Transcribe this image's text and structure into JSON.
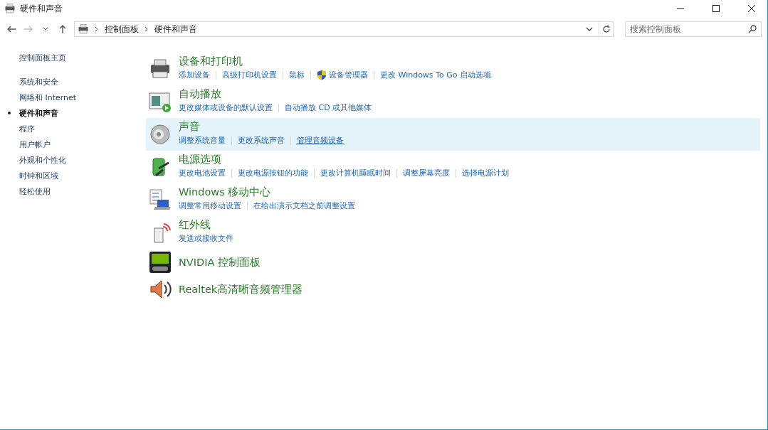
{
  "window": {
    "title": "硬件和声音"
  },
  "address_bar": {
    "path": [
      "控制面板",
      "硬件和声音"
    ]
  },
  "search": {
    "placeholder": "搜索控制面板"
  },
  "sidebar": {
    "home": "控制面板主页",
    "items": [
      {
        "label": "系统和安全",
        "selected": false
      },
      {
        "label": "网络和 Internet",
        "selected": false
      },
      {
        "label": "硬件和声音",
        "selected": true
      },
      {
        "label": "程序",
        "selected": false
      },
      {
        "label": "用户帐户",
        "selected": false
      },
      {
        "label": "外观和个性化",
        "selected": false
      },
      {
        "label": "时钟和区域",
        "selected": false
      },
      {
        "label": "轻松使用",
        "selected": false
      }
    ]
  },
  "sections": [
    {
      "kind": "printer",
      "title": "设备和打印机",
      "selected": false,
      "links": [
        {
          "kind": "plain",
          "label": "添加设备",
          "hovered": false
        },
        {
          "kind": "plain",
          "label": "高级打印机设置",
          "hovered": false
        },
        {
          "kind": "plain",
          "label": "鼠标",
          "hovered": false
        },
        {
          "kind": "admin",
          "label": "设备管理器",
          "hovered": false
        },
        {
          "kind": "plain",
          "label": "更改 Windows To Go 启动选项",
          "hovered": false
        }
      ]
    },
    {
      "kind": "autoplay",
      "title": "自动播放",
      "selected": false,
      "links": [
        {
          "kind": "plain",
          "label": "更改媒体或设备的默认设置",
          "hovered": false
        },
        {
          "kind": "plain",
          "label": "自动播放 CD 或其他媒体",
          "hovered": false
        }
      ]
    },
    {
      "kind": "sound",
      "title": "声音",
      "selected": true,
      "links": [
        {
          "kind": "plain",
          "label": "调整系统音量",
          "hovered": false
        },
        {
          "kind": "plain",
          "label": "更改系统声音",
          "hovered": false
        },
        {
          "kind": "plain",
          "label": "管理音频设备",
          "hovered": true
        }
      ]
    },
    {
      "kind": "power",
      "title": "电源选项",
      "selected": false,
      "links": [
        {
          "kind": "plain",
          "label": "更改电池设置",
          "hovered": false
        },
        {
          "kind": "plain",
          "label": "更改电源按钮的功能",
          "hovered": false
        },
        {
          "kind": "plain",
          "label": "更改计算机睡眠时间",
          "hovered": false
        },
        {
          "kind": "plain",
          "label": "调整屏幕亮度",
          "hovered": false
        },
        {
          "kind": "plain",
          "label": "选择电源计划",
          "hovered": false
        }
      ]
    },
    {
      "kind": "mobility",
      "title": "Windows 移动中心",
      "selected": false,
      "links": [
        {
          "kind": "plain",
          "label": "调整常用移动设置",
          "hovered": false
        },
        {
          "kind": "plain",
          "label": "在给出演示文档之前调整设置",
          "hovered": false
        }
      ]
    },
    {
      "kind": "infrared",
      "title": "红外线",
      "selected": false,
      "links": [
        {
          "kind": "plain",
          "label": "发送或接收文件",
          "hovered": false
        }
      ]
    },
    {
      "kind": "nvidia",
      "title": "NVIDIA 控制面板",
      "selected": false
    },
    {
      "kind": "realtek",
      "title": "Realtek高清晰音频管理器",
      "selected": false
    }
  ]
}
